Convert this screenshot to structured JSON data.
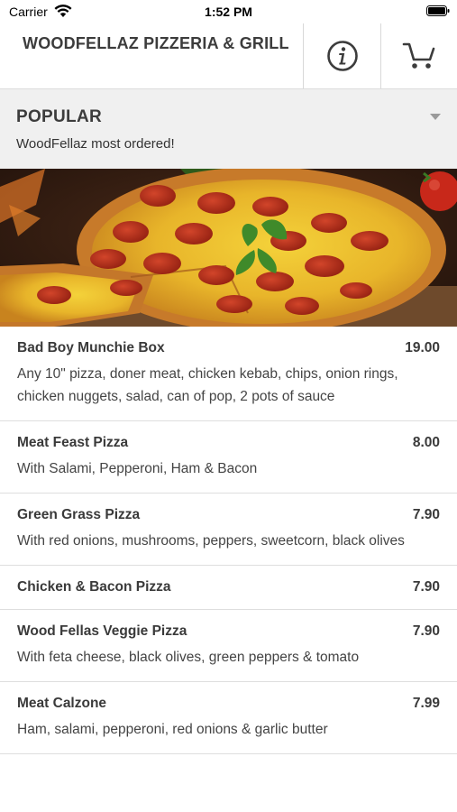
{
  "status": {
    "carrier": "Carrier",
    "time": "1:52 PM"
  },
  "header": {
    "title": "WOODFELLAZ PIZZERIA & GRILL"
  },
  "section": {
    "title": "POPULAR",
    "subtitle": "WoodFellaz most ordered!"
  },
  "items": [
    {
      "name": "Bad Boy Munchie Box",
      "price": "19.00",
      "desc": "Any 10\" pizza, doner meat, chicken kebab, chips, onion rings, chicken nuggets, salad, can of pop, 2 pots of sauce"
    },
    {
      "name": "Meat Feast Pizza",
      "price": "8.00",
      "desc": "With Salami, Pepperoni, Ham & Bacon"
    },
    {
      "name": "Green Grass Pizza",
      "price": "7.90",
      "desc": "With red onions, mushrooms, peppers, sweetcorn, black olives"
    },
    {
      "name": "Chicken & Bacon Pizza",
      "price": "7.90",
      "desc": ""
    },
    {
      "name": "Wood Fellas Veggie Pizza",
      "price": "7.90",
      "desc": "With feta cheese, black olives, green peppers & tomato"
    },
    {
      "name": "Meat Calzone",
      "price": "7.99",
      "desc": "Ham, salami, pepperoni, red onions & garlic butter"
    }
  ]
}
